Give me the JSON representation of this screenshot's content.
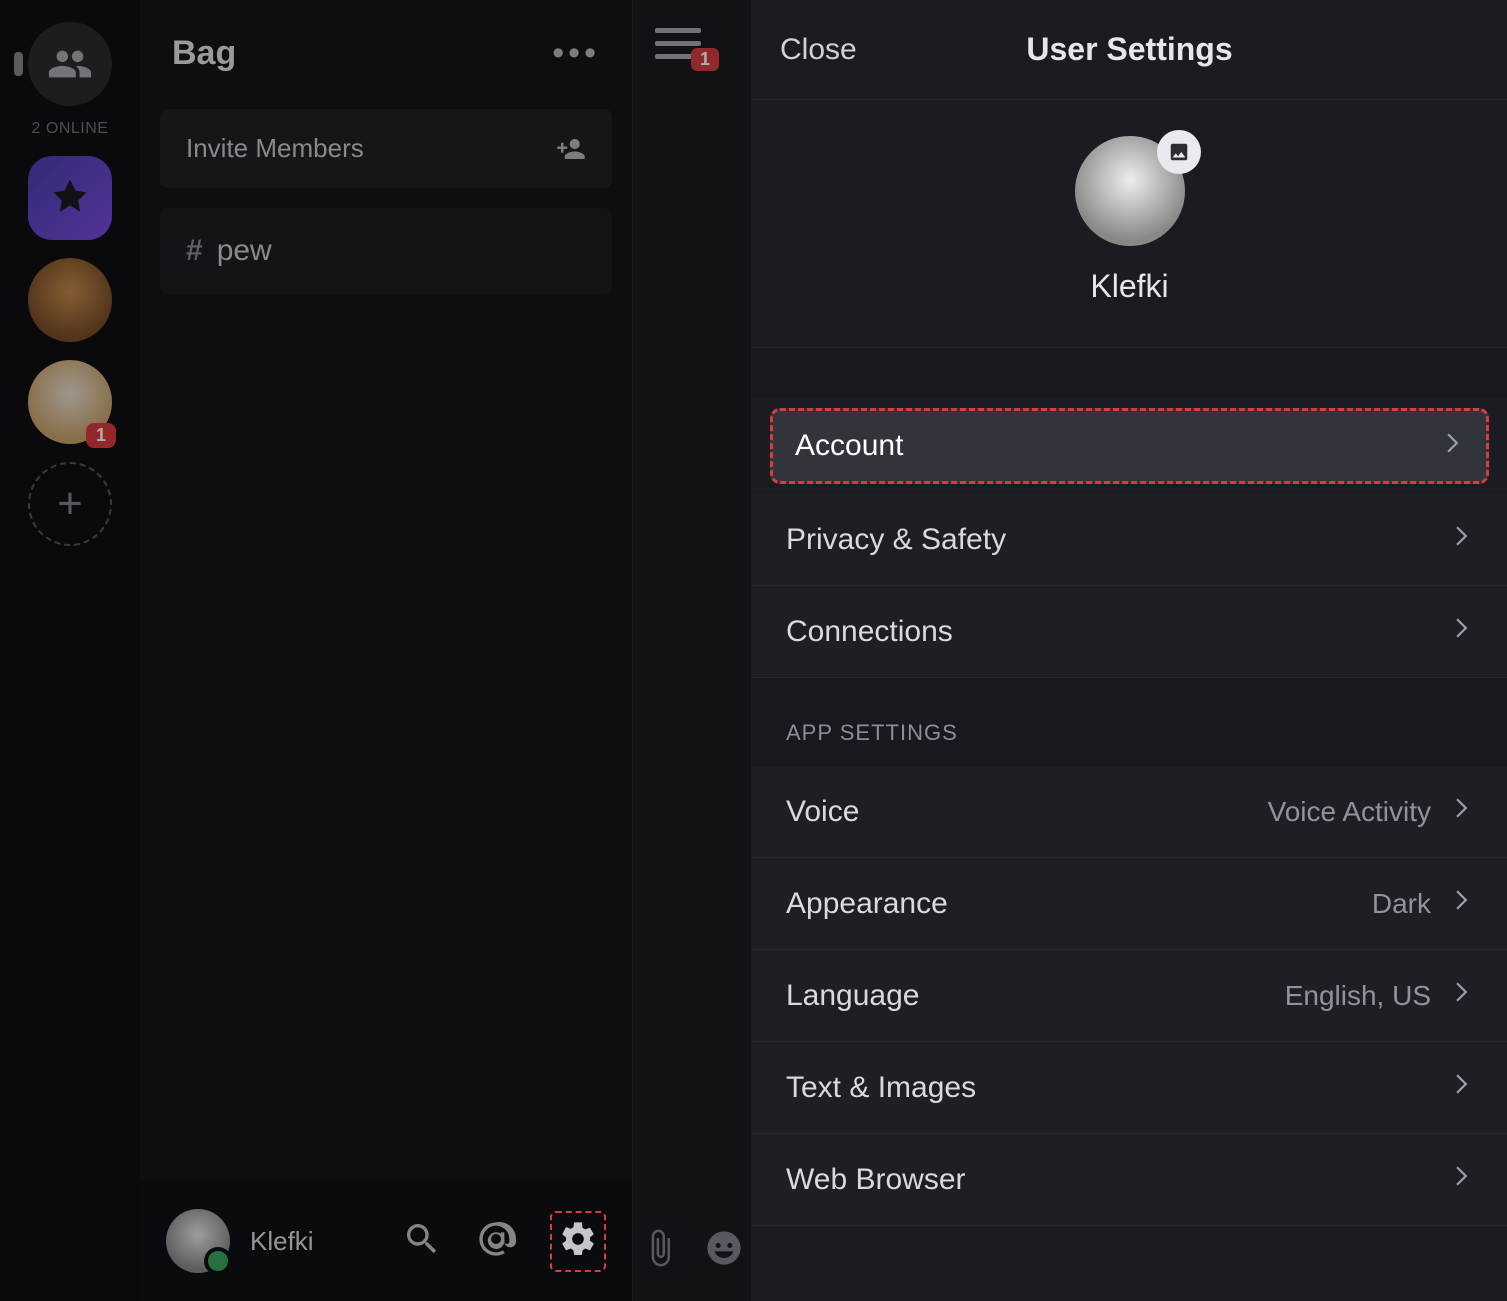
{
  "server_rail": {
    "online_label": "2 ONLINE",
    "badge_count": "1",
    "add_label": "+"
  },
  "channels": {
    "server_name": "Bag",
    "invite_label": "Invite Members",
    "items": [
      {
        "name": "pew"
      }
    ]
  },
  "user_bar": {
    "username": "Klefki"
  },
  "mid": {
    "notification_count": "1"
  },
  "settings": {
    "close_label": "Close",
    "title": "User Settings",
    "profile_name": "Klefki",
    "user_rows": [
      {
        "label": "Account",
        "value": "",
        "highlighted": true
      },
      {
        "label": "Privacy & Safety",
        "value": ""
      },
      {
        "label": "Connections",
        "value": ""
      }
    ],
    "app_section_header": "APP SETTINGS",
    "app_rows": [
      {
        "label": "Voice",
        "value": "Voice Activity"
      },
      {
        "label": "Appearance",
        "value": "Dark"
      },
      {
        "label": "Language",
        "value": "English, US"
      },
      {
        "label": "Text & Images",
        "value": ""
      },
      {
        "label": "Web Browser",
        "value": ""
      }
    ]
  }
}
